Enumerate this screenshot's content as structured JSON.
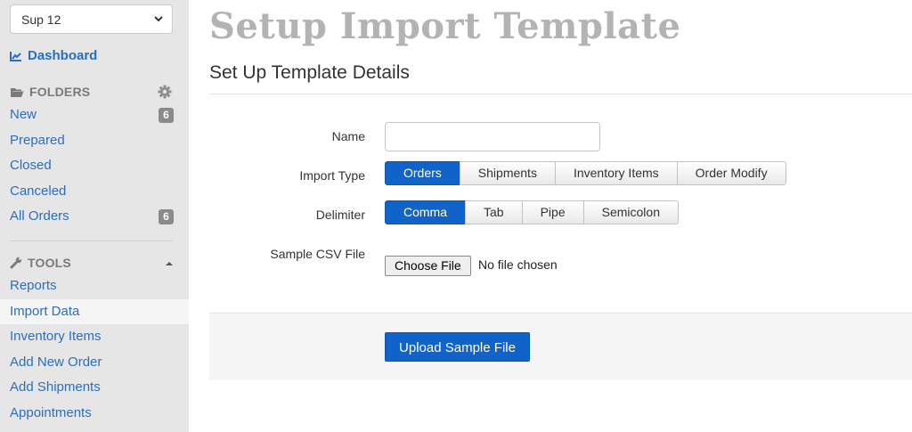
{
  "sidebar": {
    "account_select": "Sup 12",
    "dashboard_label": "Dashboard",
    "folders_heading": "FOLDERS",
    "folders": [
      {
        "label": "New",
        "count": "6"
      },
      {
        "label": "Prepared"
      },
      {
        "label": "Closed"
      },
      {
        "label": "Canceled"
      },
      {
        "label": "All Orders",
        "count": "6"
      }
    ],
    "tools_heading": "TOOLS",
    "tools": [
      {
        "label": "Reports"
      },
      {
        "label": "Import Data",
        "active": true
      },
      {
        "label": "Inventory Items"
      },
      {
        "label": "Add New Order"
      },
      {
        "label": "Add Shipments"
      },
      {
        "label": "Appointments"
      }
    ]
  },
  "main": {
    "title": "Setup Import Template",
    "subtitle": "Set Up Template Details",
    "form": {
      "name_label": "Name",
      "name_value": "",
      "import_type_label": "Import Type",
      "import_type_options": [
        "Orders",
        "Shipments",
        "Inventory Items",
        "Order Modify"
      ],
      "import_type_selected": "Orders",
      "delimiter_label": "Delimiter",
      "delimiter_options": [
        "Comma",
        "Tab",
        "Pipe",
        "Semicolon"
      ],
      "delimiter_selected": "Comma",
      "sample_csv_label": "Sample CSV File",
      "choose_file_label": "Choose File",
      "no_file_text": "No file chosen"
    },
    "upload_button": "Upload Sample File"
  },
  "colors": {
    "accent": "#0f63c9",
    "link": "#2a6fbf",
    "sidebar_bg": "#e6e6e6"
  }
}
